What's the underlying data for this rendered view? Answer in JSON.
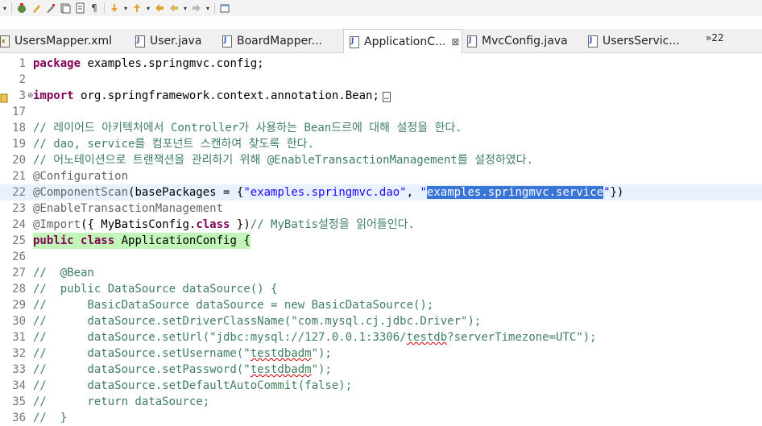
{
  "toolbar": {
    "icons": [
      "dropdown-arrow",
      "debug-icon",
      "brush-icon",
      "brush-2-icon",
      "copy-icon",
      "page-icon",
      "pilcrow-icon",
      "down-nav-icon",
      "up-nav-icon",
      "back-icon",
      "back-arrow-icon",
      "forward-arrow-icon",
      "window-icon"
    ]
  },
  "tabs": {
    "items": [
      {
        "label": "UsersMapper.xml",
        "type": "xml"
      },
      {
        "label": "User.java",
        "type": "java"
      },
      {
        "label": "BoardMapper...",
        "type": "java"
      },
      {
        "label": "ApplicationC...",
        "type": "java",
        "active": true
      },
      {
        "label": "MvcConfig.java",
        "type": "java"
      },
      {
        "label": "UsersServic...",
        "type": "java"
      }
    ],
    "close_glyph": "⊠",
    "overflow": "»22"
  },
  "editor": {
    "line_numbers": [
      "1",
      "2",
      "3",
      "17",
      "18",
      "19",
      "20",
      "21",
      "22",
      "23",
      "24",
      "25",
      "26",
      "27",
      "28",
      "29",
      "30",
      "31",
      "32",
      "33",
      "34",
      "35",
      "36"
    ],
    "lines": {
      "l1": [
        "package",
        "examples.springmvc.config;"
      ],
      "l3": [
        "import",
        "org.springframework.context.annotation.Bean;",
        "…"
      ],
      "l18": "// 레이어드 아키텍처에서 Controller가 사용하는 Bean드르에 대해 설정을 한다.",
      "l19": "// dao, service를 컴포넌트 스캔하여 찾도록 한다.",
      "l20": "// 어노테이션으로 트랜잭션을 관리하기 위해 @EnableTransactionManagement를 설정하였다.",
      "l21": "@Configuration",
      "l22": [
        "@ComponentScan",
        "(basePackages = {",
        "\"examples.springmvc.dao\"",
        ", ",
        "\"",
        "examples.springmvc.service",
        "\"",
        "})"
      ],
      "l23": "@EnableTransactionManagement",
      "l24": [
        "@Import",
        "({ MyBatisConfig.",
        "class",
        " })",
        "// MyBatis설정을 읽어들인다."
      ],
      "l25": [
        "public",
        " ",
        "class",
        " ",
        "ApplicationConfig {"
      ],
      "l27": "//  @Bean",
      "l28": "//  public DataSource dataSource() {",
      "l29": "//      BasicDataSource dataSource = new BasicDataSource();",
      "l30": "//      dataSource.setDriverClassName(\"com.mysql.cj.jdbc.Driver\");",
      "l31": [
        "//      dataSource.setUrl(\"jdbc:mysql://127.0.0.1:3306/",
        "testdb",
        "?serverTimezone=UTC\");"
      ],
      "l32": [
        "//      dataSource.setUsername(\"",
        "testdbadm",
        "\");"
      ],
      "l33": [
        "//      dataSource.setPassword(\"",
        "testdbadm",
        "\");"
      ],
      "l34": "//      dataSource.setDefaultAutoCommit(false);",
      "l35": "//      return dataSource;",
      "l36": "//  }"
    }
  },
  "colors": {
    "keyword": "#7f0055",
    "comment": "#3f7f5f",
    "string": "#2a00ff",
    "annotation": "#646464",
    "selection": "#3875d7",
    "line_highlight": "#e8f2fe"
  }
}
